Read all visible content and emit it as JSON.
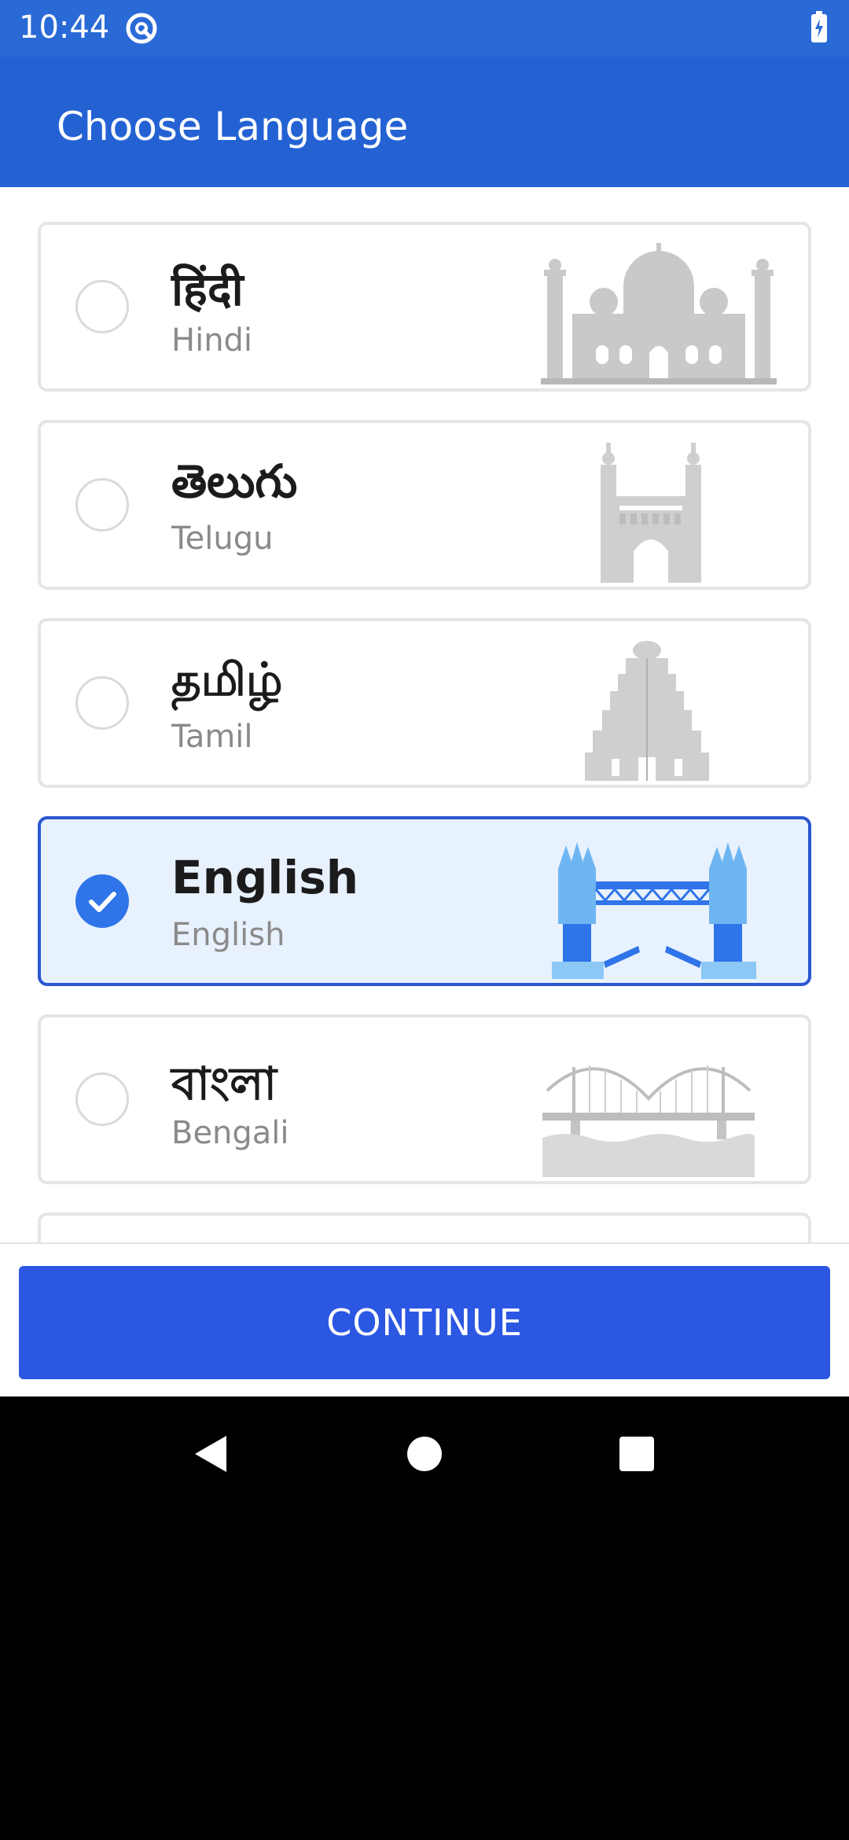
{
  "status": {
    "time": "10:44"
  },
  "appbar": {
    "title": "Choose Language"
  },
  "languages": [
    {
      "native": "हिंदी",
      "english": "Hindi",
      "selected": false,
      "illustration": "taj-mahal-icon"
    },
    {
      "native": "తెలుగు",
      "english": "Telugu",
      "selected": false,
      "illustration": "charminar-icon"
    },
    {
      "native": "தமிழ்",
      "english": "Tamil",
      "selected": false,
      "illustration": "temple-gopuram-icon"
    },
    {
      "native": "English",
      "english": "English",
      "selected": true,
      "illustration": "tower-bridge-icon"
    },
    {
      "native": "বাংলা",
      "english": "Bengali",
      "selected": false,
      "illustration": "howrah-bridge-icon"
    }
  ],
  "actions": {
    "continue_label": "CONTINUE"
  },
  "colors": {
    "status_bar": "#2a6ad6",
    "app_bar": "#2462d4",
    "selected_border": "#2b56cf",
    "selected_fill": "#e8f1fe",
    "continue_button": "#2b57e2",
    "check": "#2f74e8"
  },
  "navigation": [
    "back-icon",
    "home-icon",
    "recents-icon"
  ]
}
